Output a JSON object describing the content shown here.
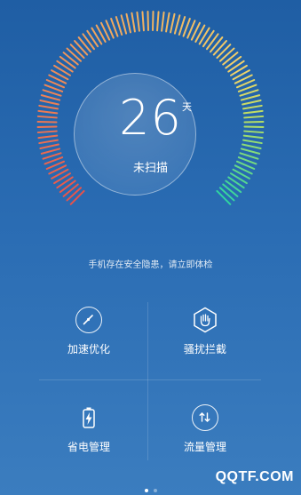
{
  "gauge": {
    "days": "26",
    "unit": "天",
    "status": "未扫描",
    "warning": "手机存在安全隐患，请立即体检",
    "colors": {
      "warm_start": "#e8524a",
      "warm_mid": "#f0a35e",
      "warm_end": "#f1d26a",
      "cool_start": "#b9de63",
      "cool_end": "#2fd6a0"
    }
  },
  "tiles": [
    {
      "label": "加速优化",
      "icon": "speedometer-icon"
    },
    {
      "label": "骚扰拦截",
      "icon": "hand-stop-icon"
    },
    {
      "label": "省电管理",
      "icon": "battery-icon"
    },
    {
      "label": "流量管理",
      "icon": "data-transfer-icon"
    }
  ],
  "pager": {
    "count": 2,
    "active": 0
  },
  "watermark": "QQTF.COM"
}
